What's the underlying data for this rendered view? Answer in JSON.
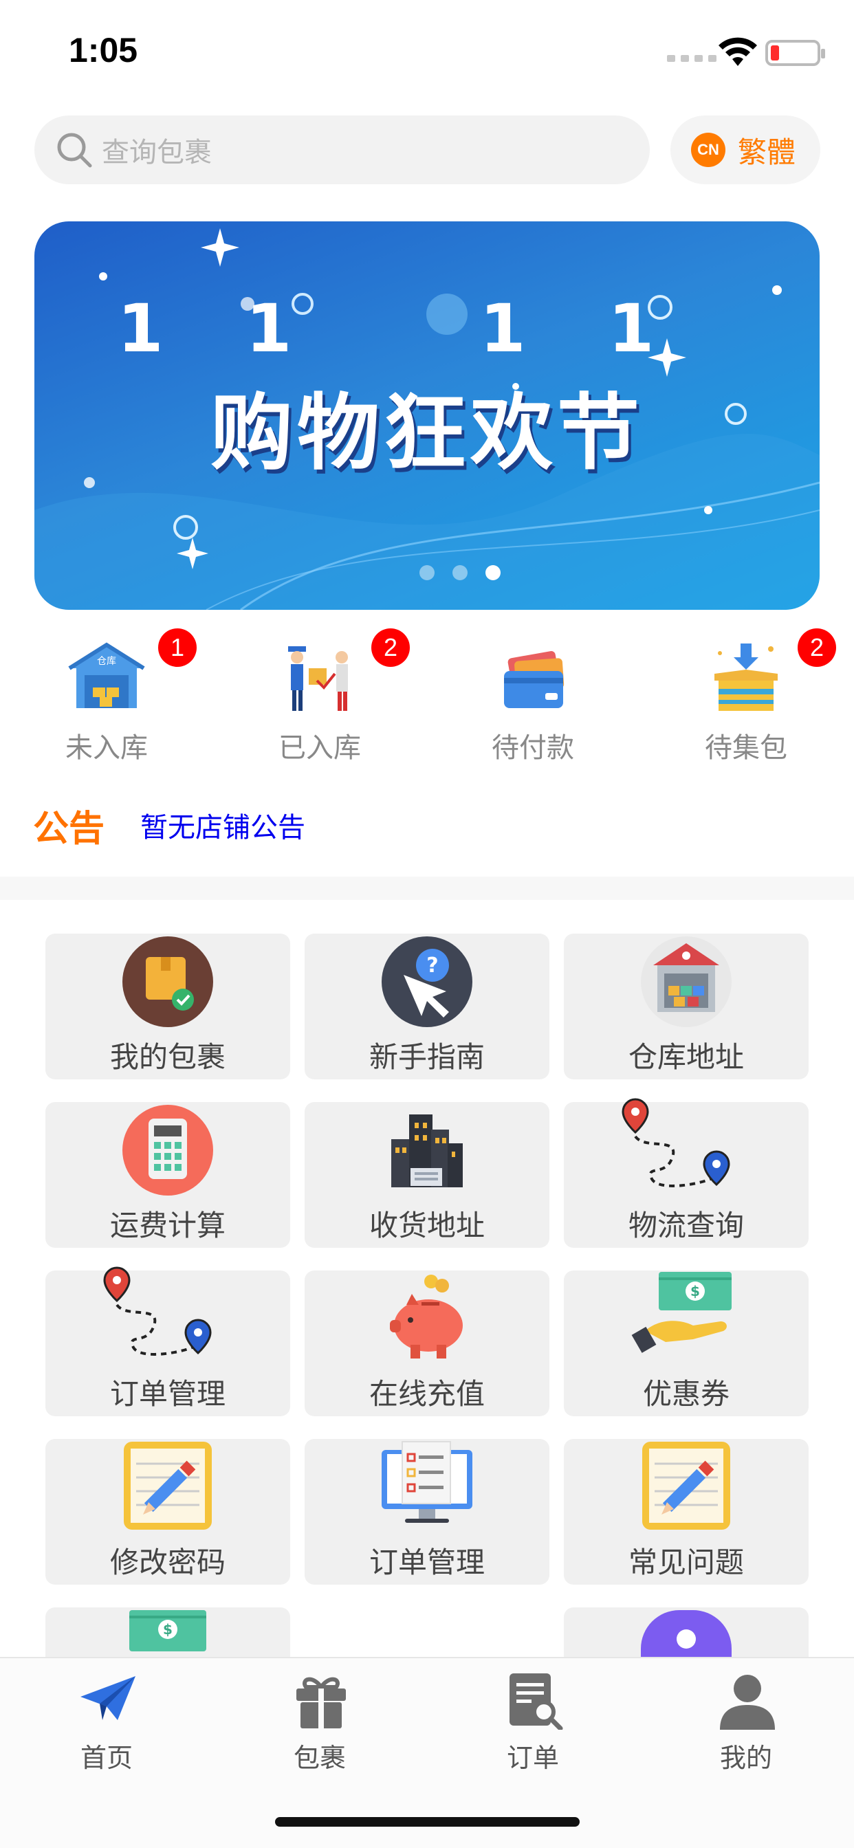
{
  "status_bar": {
    "time": "1:05"
  },
  "search": {
    "placeholder": "查询包裹"
  },
  "language": {
    "badge": "CN",
    "label": "繁體"
  },
  "banner": {
    "numbers": "11 11",
    "title": "购物狂欢节",
    "dots": 3,
    "active_dot": 3
  },
  "status_items": [
    {
      "label": "未入库",
      "badge": "1",
      "icon": "warehouse-icon"
    },
    {
      "label": "已入库",
      "badge": "2",
      "icon": "delivery-icon"
    },
    {
      "label": "待付款",
      "badge": "",
      "icon": "card-wallet-icon"
    },
    {
      "label": "待集包",
      "badge": "2",
      "icon": "box-download-icon"
    }
  ],
  "notice": {
    "title": "公告",
    "text": "暂无店铺公告"
  },
  "grid": [
    {
      "label": "我的包裹",
      "icon": "parcel-check-icon"
    },
    {
      "label": "新手指南",
      "icon": "help-cursor-icon"
    },
    {
      "label": "仓库地址",
      "icon": "warehouse-building-icon"
    },
    {
      "label": "运费计算",
      "icon": "calculator-icon"
    },
    {
      "label": "收货地址",
      "icon": "city-building-icon"
    },
    {
      "label": "物流查询",
      "icon": "route-pins-icon"
    },
    {
      "label": "订单管理",
      "icon": "route-pins-icon"
    },
    {
      "label": "在线充值",
      "icon": "piggy-bank-icon"
    },
    {
      "label": "优惠券",
      "icon": "hand-cash-icon"
    },
    {
      "label": "修改密码",
      "icon": "notepad-pencil-icon"
    },
    {
      "label": "订单管理",
      "icon": "monitor-list-icon"
    },
    {
      "label": "常见问题",
      "icon": "notepad-pencil-icon"
    }
  ],
  "tabs": [
    {
      "label": "首页",
      "icon": "paper-plane-icon",
      "active": true
    },
    {
      "label": "包裹",
      "icon": "gift-icon",
      "active": false
    },
    {
      "label": "订单",
      "icon": "document-search-icon",
      "active": false
    },
    {
      "label": "我的",
      "icon": "user-icon",
      "active": false
    }
  ],
  "colors": {
    "accent": "#ff7b00",
    "notice_link": "#0000ee",
    "badge": "#ff0000",
    "tab_active": "#2f6fe0",
    "tab_inactive": "#6d6d6d"
  }
}
